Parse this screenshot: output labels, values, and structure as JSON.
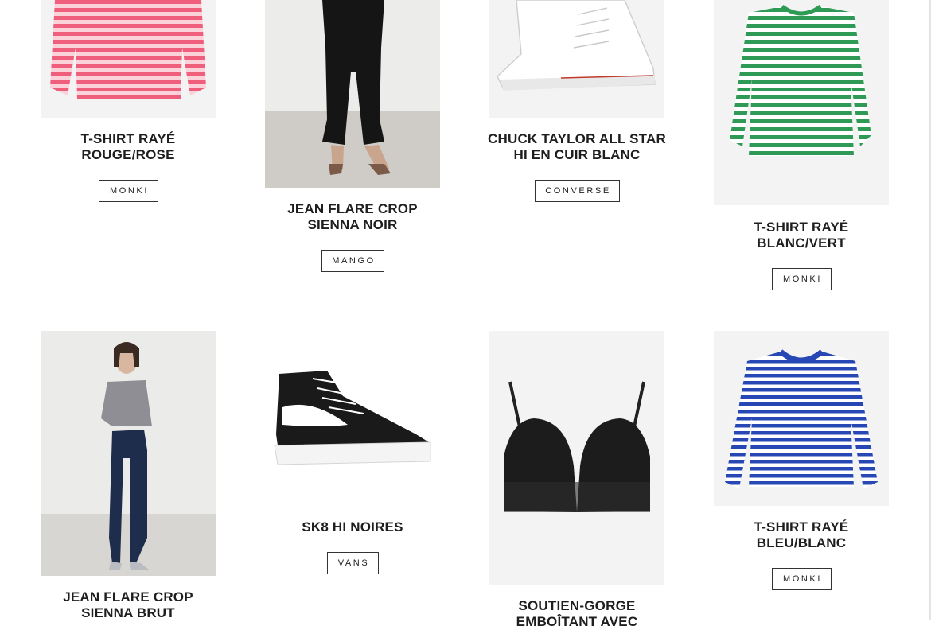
{
  "products": [
    {
      "title": "T-SHIRT RAYÉ\nROUGE/ROSE",
      "brand": "MONKI",
      "image_icon": "pink-red-striped-tshirt-image"
    },
    {
      "title": "JEAN FLARE CROP\nSIENNA NOIR",
      "brand": "MANGO",
      "image_icon": "black-flare-jeans-model-image"
    },
    {
      "title": "CHUCK TAYLOR ALL STAR\nHI EN CUIR BLANC",
      "brand": "CONVERSE",
      "image_icon": "white-high-top-sneaker-image"
    },
    {
      "title": "T-SHIRT RAYÉ\nBLANC/VERT",
      "brand": "MONKI",
      "image_icon": "green-striped-tshirt-image"
    },
    {
      "title": "JEAN FLARE CROP\nSIENNA BRUT",
      "brand": "",
      "image_icon": "indigo-flare-jeans-model-image"
    },
    {
      "title": "SK8 HI NOIRES",
      "brand": "VANS",
      "image_icon": "black-high-top-sneaker-image"
    },
    {
      "title": "SOUTIEN-GORGE\nEMBOÎTANT AVEC",
      "brand": "",
      "image_icon": "black-bra-image"
    },
    {
      "title": "T-SHIRT RAYÉ\nBLEU/BLANC",
      "brand": "MONKI",
      "image_icon": "blue-striped-tshirt-image"
    }
  ],
  "colors": {
    "photo_background": "#f3f3f3",
    "text": "#1e1e1e",
    "pink_stripe": "#f3718a",
    "green_stripe": "#2f9a55",
    "blue_stripe": "#2748b4"
  }
}
